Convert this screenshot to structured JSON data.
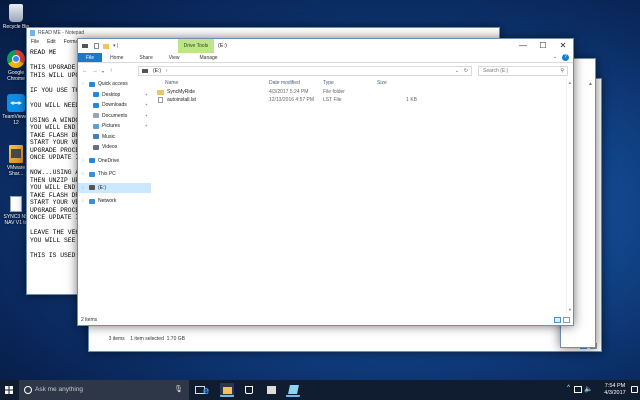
{
  "desktop": {
    "icons": [
      {
        "label": "Recycle Bin",
        "icon": "recycle-bin-icon"
      },
      {
        "label": "Google Chrome",
        "icon": "chrome-icon"
      },
      {
        "label": "TeamViewer 12",
        "icon": "teamviewer-icon"
      },
      {
        "label": "VMware Shar...",
        "icon": "vmware-shortcut-icon"
      },
      {
        "label": "SYNC3 NS NAV V1 to",
        "icon": "document-icon"
      }
    ]
  },
  "notepad": {
    "title": "READ ME - Notepad",
    "menu": [
      "File",
      "Edit",
      "Format"
    ],
    "lines": [
      "READ ME",
      "",
      "THIS UPGRADE",
      "THIS WILL UPG",
      "",
      "IF YOU USE TH",
      "",
      "YOU WILL NEED",
      "",
      "USING A WINDO",
      "YOU WILL END",
      "TAKE FLASH DR",
      "START YOUR VE",
      "UPGRADE PROCE",
      "ONCE UPDATE I",
      "",
      "NOW...USING A",
      "THEN UNZIP UP",
      "YOU WILL END",
      "TAKE FLASH DR",
      "START YOUR VE",
      "UPGRADE PROCE",
      "ONCE UPDATE I",
      "",
      "LEAVE THE VEH",
      "YOU WILL SEE",
      "",
      "THIS IS USED"
    ]
  },
  "explorer_back": {
    "status": "3 items    1 item selected  1.70 GB"
  },
  "explorer": {
    "title": "(E:)",
    "context_tab": "Drive Tools",
    "ribbon_tabs": [
      "File",
      "Home",
      "Share",
      "View",
      "Manage"
    ],
    "address": "(E:)",
    "search_placeholder": "Search (E:)",
    "nav": [
      {
        "label": "Quick access",
        "icon": "star-icon",
        "color": "#1e88e5",
        "level": 0,
        "pin": false
      },
      {
        "label": "Desktop",
        "icon": "desktop-icon",
        "color": "#1e88e5",
        "level": 1,
        "pin": true
      },
      {
        "label": "Downloads",
        "icon": "download-icon",
        "color": "#1e88e5",
        "level": 1,
        "pin": true
      },
      {
        "label": "Documents",
        "icon": "documents-icon",
        "color": "#9aa4b0",
        "level": 1,
        "pin": true
      },
      {
        "label": "Pictures",
        "icon": "pictures-icon",
        "color": "#5aa0d8",
        "level": 1,
        "pin": true
      },
      {
        "label": "Music",
        "icon": "music-icon",
        "color": "#3f7fc2",
        "level": 1,
        "pin": false
      },
      {
        "label": "Videos",
        "icon": "videos-icon",
        "color": "#6a6a8a",
        "level": 1,
        "pin": false
      },
      {
        "label": "",
        "icon": "",
        "color": "",
        "level": 0,
        "pin": false
      },
      {
        "label": "OneDrive",
        "icon": "onedrive-icon",
        "color": "#1e88e5",
        "level": 0,
        "pin": false
      },
      {
        "label": "",
        "icon": "",
        "color": "",
        "level": 0,
        "pin": false
      },
      {
        "label": "This PC",
        "icon": "this-pc-icon",
        "color": "#3b8fd6",
        "level": 0,
        "pin": false
      },
      {
        "label": "",
        "icon": "",
        "color": "",
        "level": 0,
        "pin": false
      },
      {
        "label": "(E:)",
        "icon": "drive-icon",
        "color": "#555555",
        "level": 0,
        "pin": false,
        "selected": true
      },
      {
        "label": "",
        "icon": "",
        "color": "",
        "level": 0,
        "pin": false
      },
      {
        "label": "Network",
        "icon": "network-icon",
        "color": "#3b8fd6",
        "level": 0,
        "pin": false
      }
    ],
    "columns": [
      "Name",
      "Date modified",
      "Type",
      "Size"
    ],
    "rows": [
      {
        "name": "SyncMyRide",
        "date": "4/3/2017 5:24 PM",
        "type": "File folder",
        "size": "",
        "icon": "folder-icon"
      },
      {
        "name": "autoinstall.lst",
        "date": "12/13/2016 4:57 PM",
        "type": "LST File",
        "size": "1 KB",
        "icon": "file-icon"
      }
    ],
    "status": "2 items"
  },
  "taskbar": {
    "search_placeholder": "Ask me anything",
    "time": "7:54 PM",
    "date": "4/3/2017"
  },
  "colors": {
    "accent": "#1979ca",
    "drive_tools": "#a6d85a",
    "taskbar": "#101c30"
  }
}
